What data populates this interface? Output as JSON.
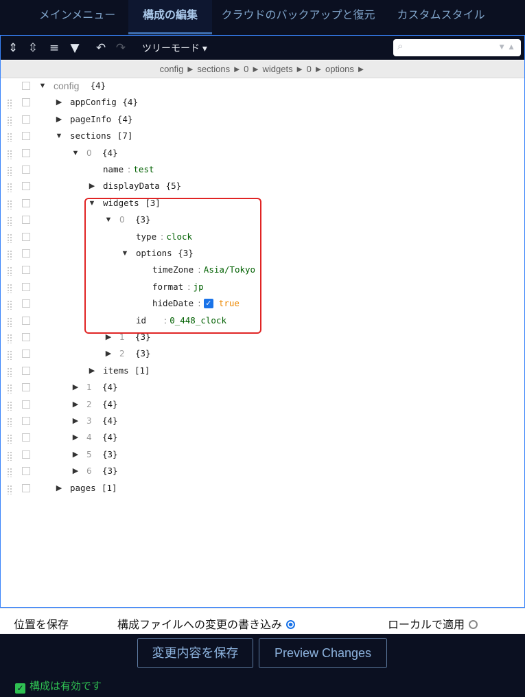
{
  "tabs": [
    {
      "label": "メインメニュー",
      "active": false
    },
    {
      "label": "構成の編集",
      "active": true
    },
    {
      "label": "クラウドのバックアップと復元",
      "active": false
    },
    {
      "label": "カスタムスタイル",
      "active": false
    }
  ],
  "toolbar": {
    "mode_label": "ツリーモード ▾",
    "icons": [
      "expand-all-icon",
      "collapse-all-icon",
      "sort-icon",
      "filter-icon",
      "undo-icon",
      "redo-icon"
    ]
  },
  "search": {
    "placeholder": ""
  },
  "breadcrumb": "config ► sections ► 0 ► widgets ► 0 ► options ►",
  "tree": [
    {
      "depth": 0,
      "toggle": "▼",
      "key": "config",
      "count": "{4}",
      "root": true
    },
    {
      "depth": 1,
      "toggle": "▶",
      "key": "appConfig",
      "count": "{4}"
    },
    {
      "depth": 1,
      "toggle": "▶",
      "key": "pageInfo",
      "count": "{4}"
    },
    {
      "depth": 1,
      "toggle": "▼",
      "key": "sections",
      "count": "[7]"
    },
    {
      "depth": 2,
      "toggle": "▼",
      "index": "0",
      "count": "{4}"
    },
    {
      "depth": 3,
      "toggle": "",
      "key": "name",
      "value": "test"
    },
    {
      "depth": 3,
      "toggle": "▶",
      "key": "displayData",
      "count": "{5}"
    },
    {
      "depth": 3,
      "toggle": "▼",
      "key": "widgets",
      "count": "[3]"
    },
    {
      "depth": 4,
      "toggle": "▼",
      "index": "0",
      "count": "{3}"
    },
    {
      "depth": 5,
      "toggle": "",
      "key": "type",
      "value": "clock"
    },
    {
      "depth": 5,
      "toggle": "▼",
      "key": "options",
      "count": "{3}"
    },
    {
      "depth": 6,
      "toggle": "",
      "key": "timeZone",
      "value": "Asia/Tokyo"
    },
    {
      "depth": 6,
      "toggle": "",
      "key": "format",
      "value": "jp"
    },
    {
      "depth": 6,
      "toggle": "",
      "key": "hideDate",
      "value": "true",
      "bool": true
    },
    {
      "depth": 5,
      "toggle": "",
      "key": "id",
      "value": "0_448_clock"
    },
    {
      "depth": 4,
      "toggle": "▶",
      "index": "1",
      "count": "{3}"
    },
    {
      "depth": 4,
      "toggle": "▶",
      "index": "2",
      "count": "{3}"
    },
    {
      "depth": 3,
      "toggle": "▶",
      "key": "items",
      "count": "[1]"
    },
    {
      "depth": 2,
      "toggle": "▶",
      "index": "1",
      "count": "{4}"
    },
    {
      "depth": 2,
      "toggle": "▶",
      "index": "2",
      "count": "{4}"
    },
    {
      "depth": 2,
      "toggle": "▶",
      "index": "3",
      "count": "{4}"
    },
    {
      "depth": 2,
      "toggle": "▶",
      "index": "4",
      "count": "{4}"
    },
    {
      "depth": 2,
      "toggle": "▶",
      "index": "5",
      "count": "{3}"
    },
    {
      "depth": 2,
      "toggle": "▶",
      "index": "6",
      "count": "{3}"
    },
    {
      "depth": 1,
      "toggle": "▶",
      "key": "pages",
      "count": "[1]"
    }
  ],
  "bottom_bar": {
    "save_position": "位置を保存",
    "write_config": "構成ファイルへの変更の書き込み",
    "write_config_selected": true,
    "apply_local": "ローカルで適用",
    "apply_local_selected": false
  },
  "buttons": {
    "save_changes": "変更内容を保存",
    "preview_changes": "Preview Changes"
  },
  "status": {
    "valid_text": "構成は有効です"
  },
  "colors": {
    "accent": "#1a73e8",
    "valid": "#2fc052",
    "highlight": "#e02424"
  }
}
